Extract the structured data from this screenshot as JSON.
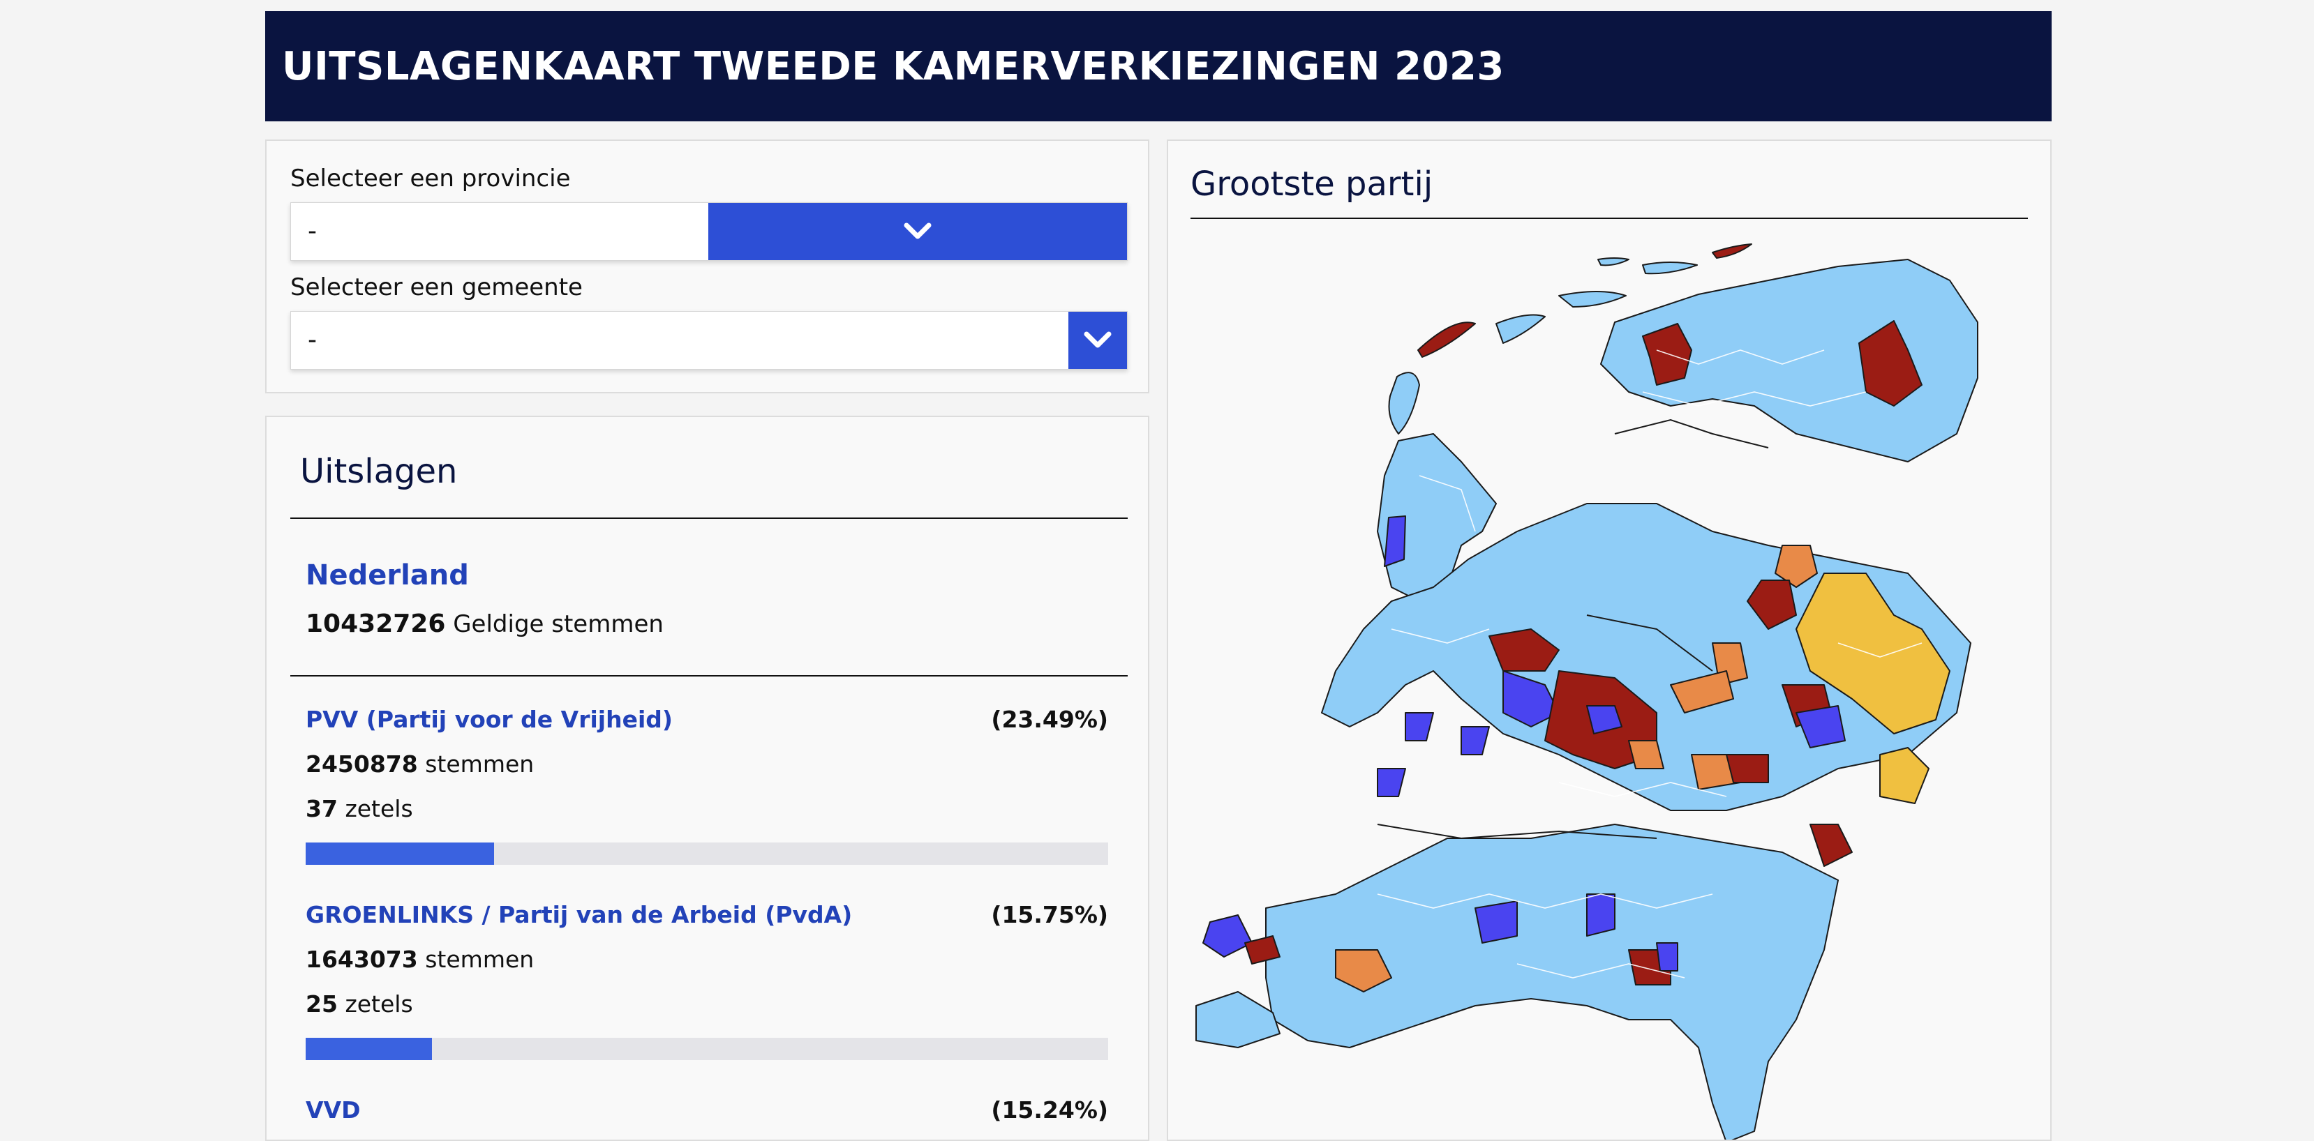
{
  "header": {
    "title": "UITSLAGENKAART TWEEDE KAMERVERKIEZINGEN 2023"
  },
  "selectors": {
    "province": {
      "label": "Selecteer een provincie",
      "value": "-",
      "icon": "chevron-down-icon"
    },
    "municipality": {
      "label": "Selecteer een gemeente",
      "value": "-",
      "icon": "chevron-down-icon"
    }
  },
  "results": {
    "title": "Uitslagen",
    "region": "Nederland",
    "valid_votes": "10432726",
    "valid_votes_label": "Geldige stemmen",
    "votes_unit": "stemmen",
    "seats_unit": "zetels",
    "parties": [
      {
        "name": "PVV (Partij voor de Vrijheid)",
        "percent": "(23.49%)",
        "share": 23.49,
        "votes": "2450878",
        "seats": "37"
      },
      {
        "name": "GROENLINKS / Partij van de Arbeid (PvdA)",
        "percent": "(15.75%)",
        "share": 15.75,
        "votes": "1643073",
        "seats": "25"
      },
      {
        "name": "VVD",
        "percent": "(15.24%)",
        "share": 15.24,
        "votes": "",
        "seats": ""
      }
    ]
  },
  "map": {
    "title": "Grootste partij",
    "colors": {
      "light_blue": "#8fcdf7",
      "dark_red": "#9b1c14",
      "purple_blue": "#4a44f0",
      "orange": "#e88a48",
      "yellow": "#f0c040"
    }
  }
}
